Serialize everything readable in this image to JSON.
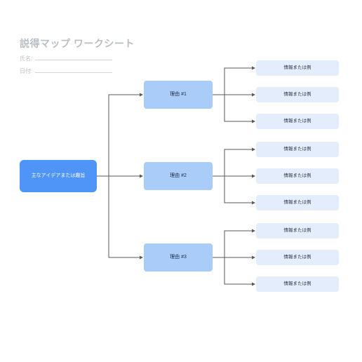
{
  "header": {
    "title": "説得マップ ワークシート",
    "name_label": "氏名:",
    "date_label": "日付:"
  },
  "nodes": {
    "main": "主なアイデアまたは趣旨",
    "reasons": [
      "理由 #1",
      "理由 #2",
      "理由 #3"
    ],
    "info": "情報または例"
  },
  "colors": {
    "main": "#4f94f7",
    "reason": "#a9ccf8",
    "info": "#e3edfb",
    "muted": "#b9bdc4"
  }
}
